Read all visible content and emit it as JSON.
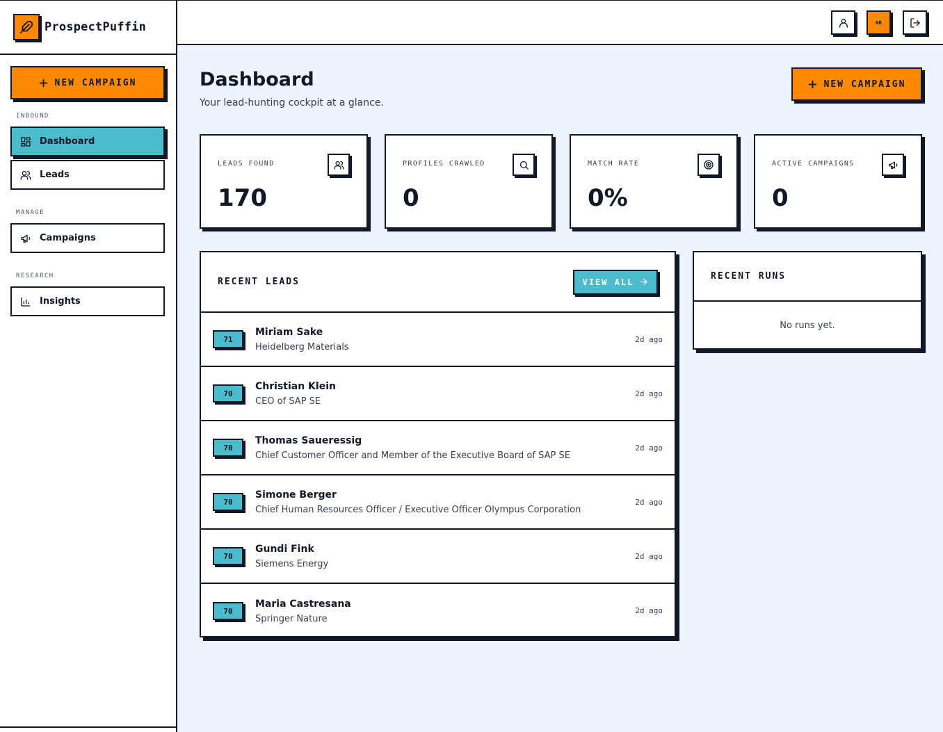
{
  "app": {
    "name": "ProspectPuffin",
    "icons": {
      "logo": "feather-icon",
      "plus": "plus-icon"
    },
    "colors": {
      "accent": "#ff8a00",
      "teal": "#4bbccc",
      "ink": "#111827",
      "bg": "#eef3fd"
    }
  },
  "sidebar": {
    "new_campaign_label": "NEW CAMPAIGN",
    "sections": {
      "inbound": "INBOUND",
      "manage": "MANAGE",
      "research": "RESEARCH"
    },
    "items": [
      {
        "label": "Dashboard",
        "icon": "grid-icon",
        "active": true
      },
      {
        "label": "Leads",
        "icon": "users-icon",
        "active": false
      },
      {
        "label": "Campaigns",
        "icon": "megaphone-icon",
        "active": false
      },
      {
        "label": "Insights",
        "icon": "bar-chart-icon",
        "active": false
      }
    ]
  },
  "topbar": {
    "user_icon": "user-icon",
    "initials_badge": "NB",
    "logout_icon": "logout-icon"
  },
  "main": {
    "title": "Dashboard",
    "subtitle": "Your lead-hunting cockpit at a glance.",
    "new_campaign_label": "NEW CAMPAIGN",
    "stats": [
      {
        "label": "LEADS FOUND",
        "value": "170",
        "icon": "users-icon"
      },
      {
        "label": "PROFILES CRAWLED",
        "value": "0",
        "icon": "search-icon"
      },
      {
        "label": "MATCH RATE",
        "value": "0%",
        "icon": "target-icon"
      },
      {
        "label": "ACTIVE CAMPAIGNS",
        "value": "0",
        "icon": "megaphone-icon"
      }
    ],
    "recent_leads": {
      "title": "RECENT LEADS",
      "view_all_label": "VIEW ALL",
      "rows": [
        {
          "score": "71",
          "name": "Miriam Sake",
          "subtitle": "Heidelberg Materials",
          "time": "2d ago"
        },
        {
          "score": "70",
          "name": "Christian Klein",
          "subtitle": "CEO of SAP SE",
          "time": "2d ago"
        },
        {
          "score": "70",
          "name": "Thomas Saueressig",
          "subtitle": "Chief Customer Officer and Member of the Executive Board of SAP SE",
          "time": "2d ago"
        },
        {
          "score": "70",
          "name": "Simone Berger",
          "subtitle": "Chief Human Resources Officer / Executive Officer Olympus Corporation",
          "time": "2d ago"
        },
        {
          "score": "70",
          "name": "Gundi Fink",
          "subtitle": "Siemens Energy",
          "time": "2d ago"
        },
        {
          "score": "70",
          "name": "Maria Castresana",
          "subtitle": "Springer Nature",
          "time": "2d ago"
        }
      ]
    },
    "recent_runs": {
      "title": "RECENT RUNS",
      "empty_text": "No runs yet."
    }
  }
}
